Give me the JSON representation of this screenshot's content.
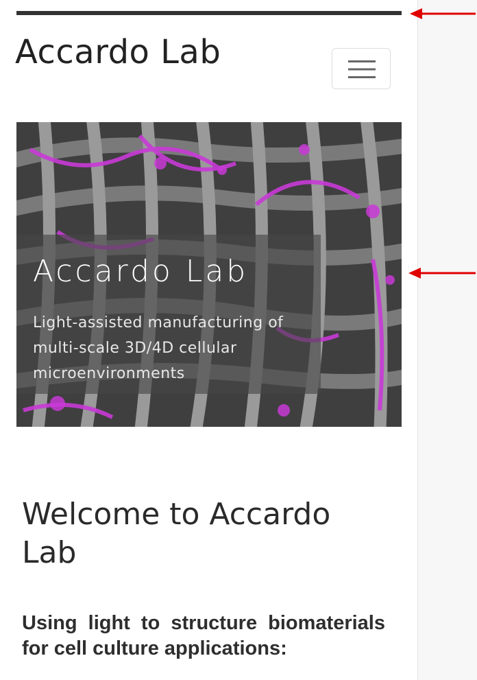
{
  "navbar": {
    "brand": "Accardo Lab",
    "toggler_icon": "hamburger-menu-icon"
  },
  "hero": {
    "title": "Accardo Lab",
    "subtitle": "Light-assisted manufacturing of multi-scale 3D/4D cellular microenvironments"
  },
  "content": {
    "welcome_heading": "Welcome to Accardo Lab",
    "intro_text": "Using light to structure biomaterials for cell culture applications:"
  },
  "annotations": {
    "arrow_color": "#e00000"
  },
  "colors": {
    "accent_magenta": "#c83ad6",
    "top_bar": "#333333",
    "text": "#2a2a2a"
  }
}
